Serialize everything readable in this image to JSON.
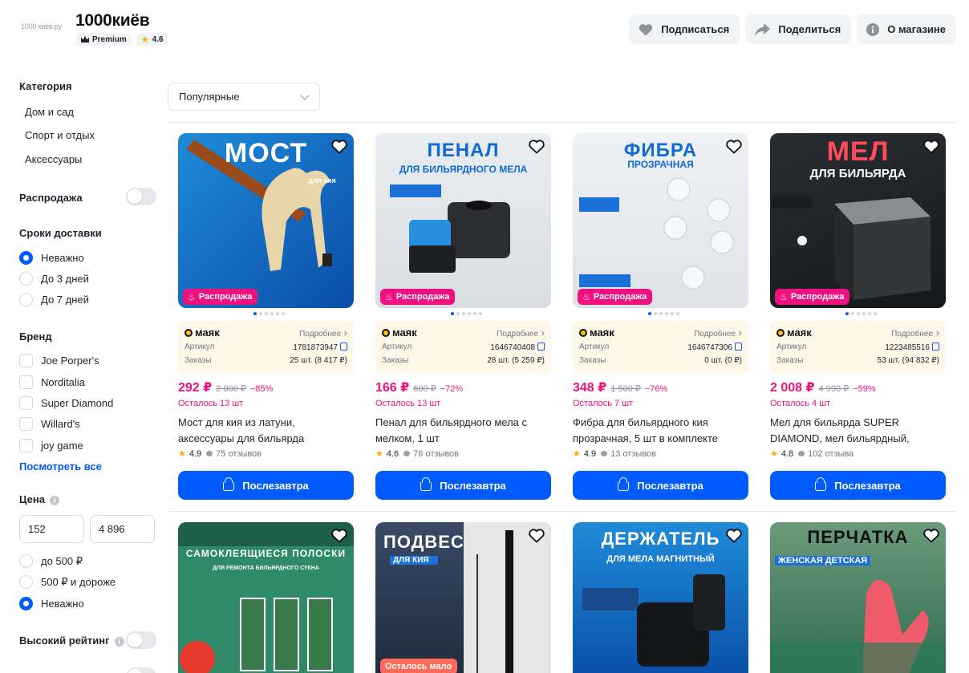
{
  "shop": {
    "logo_text": "1000 киёв.ру",
    "name": "1000киёв",
    "premium_label": "Premium",
    "rating": "4.6"
  },
  "header_buttons": {
    "subscribe": "Подписаться",
    "share": "Поделиться",
    "about": "О магазине"
  },
  "sidebar": {
    "category_title": "Категория",
    "categories": [
      "Дом и сад",
      "Спорт и отдых",
      "Аксессуары"
    ],
    "sale_label": "Распродажа",
    "delivery_title": "Сроки доставки",
    "delivery_options": [
      "Неважно",
      "До 3 дней",
      "До 7 дней"
    ],
    "brand_title": "Бренд",
    "brands": [
      "Joe Porper's",
      "Norditalia",
      "Super Diamond",
      "Willard's",
      "joy game"
    ],
    "see_all": "Посмотреть все",
    "price_title": "Цена",
    "price_from": "152",
    "price_to": "4 896",
    "price_options": [
      "до 500 ₽",
      "500 ₽ и дороже",
      "Неважно"
    ],
    "high_rating_label": "Высокий рейтинг"
  },
  "sort": {
    "selected": "Популярные"
  },
  "common": {
    "brand_name": "маяк",
    "more": "Подробнее",
    "sku_label": "Артикул",
    "orders_label": "Заказы",
    "sale_badge": "Распродажа",
    "buy_label": "Послезавтра"
  },
  "products": [
    {
      "thumb_title": "МОСТ",
      "thumb_sub": "для кия",
      "sku": "1781873947",
      "orders": "25 шт. (8 417 ₽)",
      "price": "292 ₽",
      "old_price": "2 000 ₽",
      "discount": "−85%",
      "stock": "Осталось 13 шт",
      "name": "Мост для кия из латуни, аксессуары для бильярда",
      "rating": "4.9",
      "reviews": "75 отзывов"
    },
    {
      "thumb_title": "ПЕНАЛ",
      "thumb_sub": "ДЛЯ БИЛЬЯРДНОГО МЕЛА",
      "sku": "1646740408",
      "orders": "28 шт. (5 259 ₽)",
      "price": "166 ₽",
      "old_price": "600 ₽",
      "discount": "−72%",
      "stock": "Осталось 13 шт",
      "name": "Пенал для бильярдного мела с мелком, 1 шт",
      "rating": "4.6",
      "reviews": "76 отзывов"
    },
    {
      "thumb_title": "ФИБРА",
      "thumb_sub": "ПРОЗРАЧНАЯ",
      "sku": "1646747306",
      "orders": "0 шт. (0 ₽)",
      "price": "348 ₽",
      "old_price": "1 500 ₽",
      "discount": "−76%",
      "stock": "Осталось 7 шт",
      "name": "Фибра для бильярдного кия прозрачная, 5 шт в комплекте",
      "rating": "4.9",
      "reviews": "13 отзывов"
    },
    {
      "thumb_title": "МЕЛ",
      "thumb_sub": "ДЛЯ БИЛЬЯРДА",
      "sku": "1223485516",
      "orders": "53 шт. (94 832 ₽)",
      "price": "2 008 ₽",
      "old_price": "4 990 ₽",
      "discount": "−59%",
      "stock": "Осталось 4 шт",
      "name": "Мел для бильярда SUPER DIAMOND, мел бильярдный, серы…",
      "rating": "4.8",
      "reviews": "102 отзыва"
    }
  ],
  "row2": [
    {
      "thumb_title": "САМОКЛЕЯЩИЕСЯ ПОЛОСКИ",
      "thumb_sub": "ДЛЯ РЕМОНТА БИЛЬЯРДНОГО СУКНА"
    },
    {
      "thumb_title": "ПОДВЕС",
      "thumb_sub": "ДЛЯ КИЯ",
      "badge": "Осталось мало"
    },
    {
      "thumb_title": "ДЕРЖАТЕЛЬ",
      "thumb_sub": "ДЛЯ МЕЛА   МАГНИТНЫЙ"
    },
    {
      "thumb_title": "ПЕРЧАТКА",
      "thumb_sub": "ЖЕНСКАЯ ДЕТСКАЯ"
    }
  ]
}
